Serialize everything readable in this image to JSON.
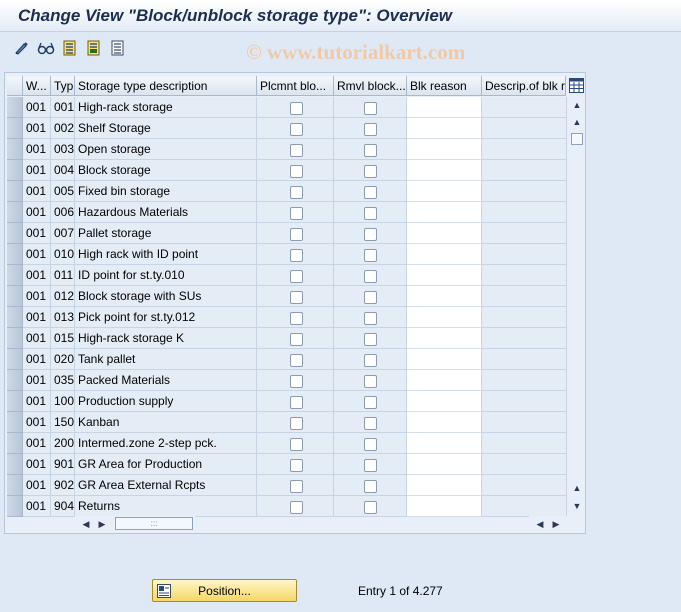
{
  "window": {
    "title": "Change View \"Block/unblock storage type\": Overview"
  },
  "toolbar": {
    "icons": [
      "edit-pencil-icon",
      "glasses-display-icon",
      "select-all-icon",
      "select-block-icon",
      "deselect-all-icon"
    ]
  },
  "watermark": "© www.tutorialkart.com",
  "table": {
    "columns": [
      "W...",
      "Typ",
      "Storage type description",
      "Plcmnt blo...",
      "Rmvl block...",
      "Blk reason",
      "Descrip.of blk r"
    ],
    "rows": [
      {
        "w": "001",
        "typ": "001",
        "desc": "High-rack storage"
      },
      {
        "w": "001",
        "typ": "002",
        "desc": "Shelf Storage"
      },
      {
        "w": "001",
        "typ": "003",
        "desc": "Open storage"
      },
      {
        "w": "001",
        "typ": "004",
        "desc": "Block storage"
      },
      {
        "w": "001",
        "typ": "005",
        "desc": "Fixed bin storage"
      },
      {
        "w": "001",
        "typ": "006",
        "desc": "Hazardous Materials"
      },
      {
        "w": "001",
        "typ": "007",
        "desc": "Pallet storage"
      },
      {
        "w": "001",
        "typ": "010",
        "desc": "High rack with ID point"
      },
      {
        "w": "001",
        "typ": "011",
        "desc": "ID point for st.ty.010"
      },
      {
        "w": "001",
        "typ": "012",
        "desc": "Block storage with SUs"
      },
      {
        "w": "001",
        "typ": "013",
        "desc": "Pick point for st.ty.012"
      },
      {
        "w": "001",
        "typ": "015",
        "desc": "High-rack storage K"
      },
      {
        "w": "001",
        "typ": "020",
        "desc": "Tank pallet"
      },
      {
        "w": "001",
        "typ": "035",
        "desc": "Packed Materials"
      },
      {
        "w": "001",
        "typ": "100",
        "desc": "Production supply"
      },
      {
        "w": "001",
        "typ": "150",
        "desc": "Kanban"
      },
      {
        "w": "001",
        "typ": "200",
        "desc": "Intermed.zone 2-step pck."
      },
      {
        "w": "001",
        "typ": "901",
        "desc": "GR Area for Production"
      },
      {
        "w": "001",
        "typ": "902",
        "desc": "GR Area External Rcpts"
      },
      {
        "w": "001",
        "typ": "904",
        "desc": "Returns"
      }
    ]
  },
  "footer": {
    "position_button": "Position...",
    "entry_text": "Entry 1 of 4.277"
  },
  "colors": {
    "title": "#1c2d52",
    "background": "#dfe9f5",
    "button": "#f5d766"
  }
}
